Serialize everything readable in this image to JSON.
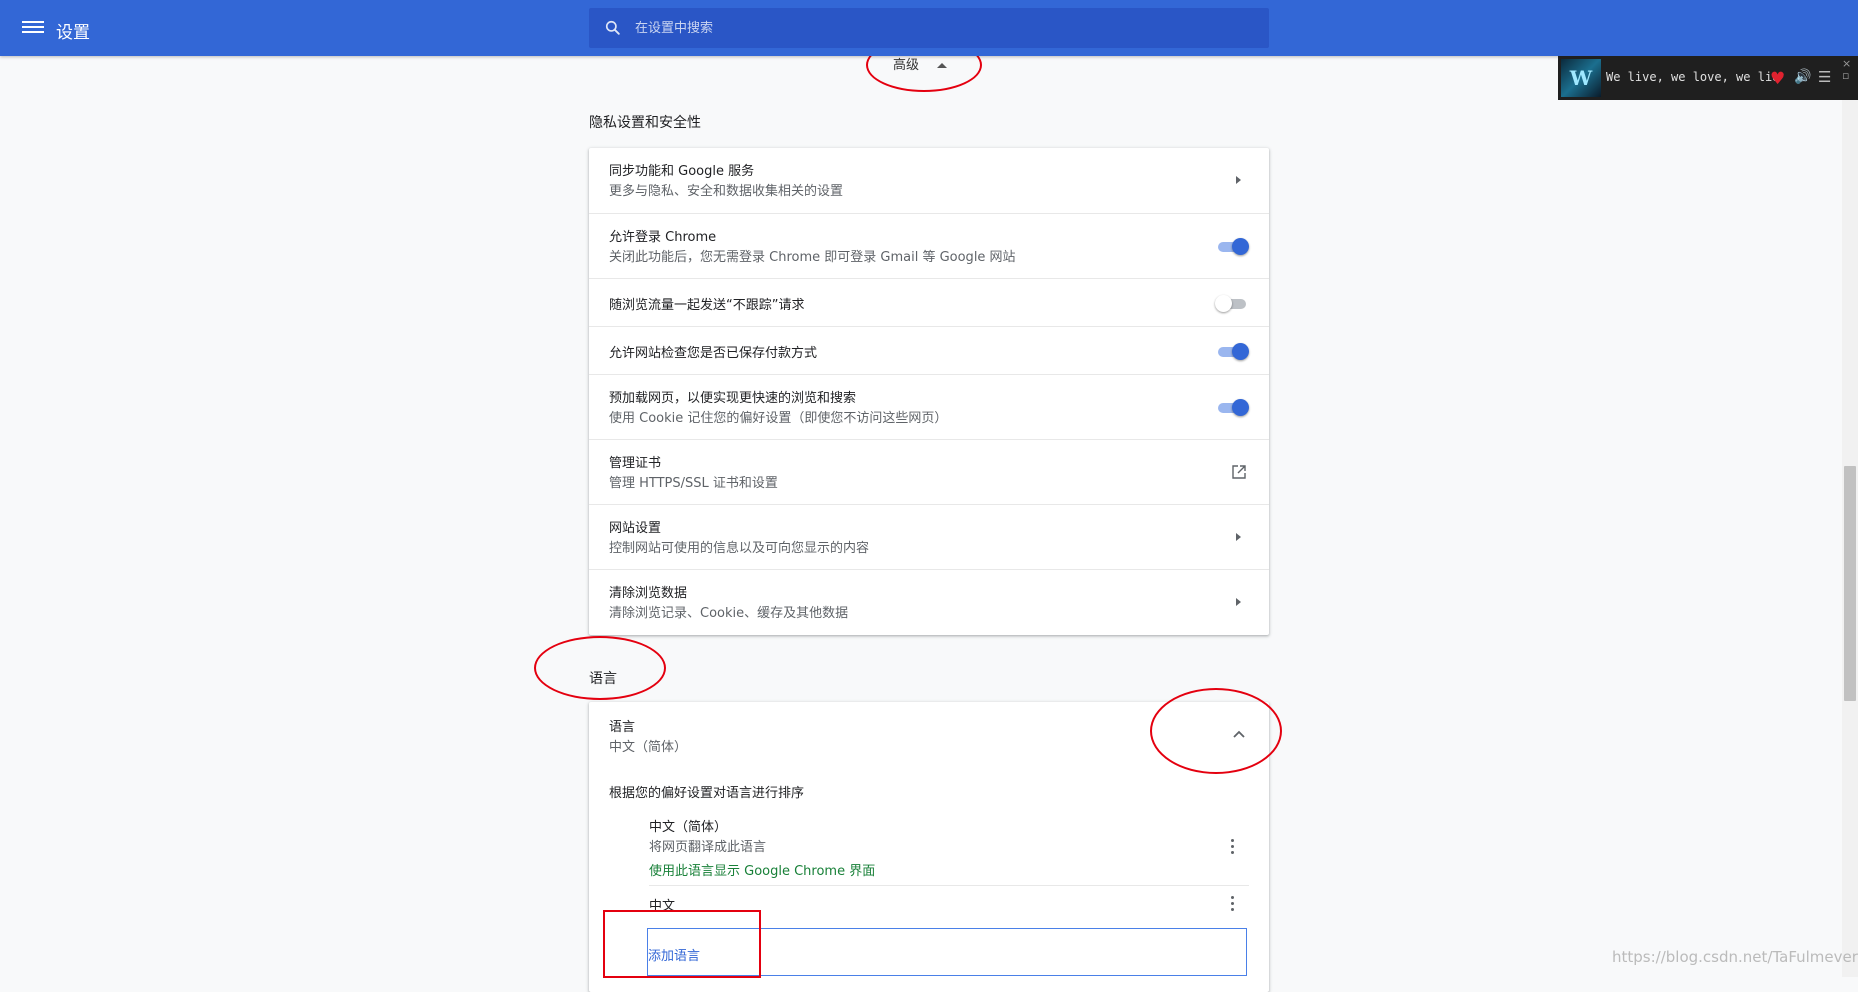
{
  "header": {
    "title": "设置",
    "search_placeholder": "在设置中搜索"
  },
  "music": {
    "thumb_letter": "W",
    "text": "We live, we love, we lie"
  },
  "advanced": {
    "label": "高级"
  },
  "privacy": {
    "section_title": "隐私设置和安全性",
    "rows": [
      {
        "label": "同步功能和 Google 服务",
        "sub": "更多与隐私、安全和数据收集相关的设置",
        "control": "arrow"
      },
      {
        "label": "允许登录 Chrome",
        "sub": "关闭此功能后，您无需登录 Chrome 即可登录 Gmail 等 Google 网站",
        "control": "toggle",
        "state": "on"
      },
      {
        "label": "随浏览流量一起发送“不跟踪”请求",
        "control": "toggle",
        "state": "off"
      },
      {
        "label": "允许网站检查您是否已保存付款方式",
        "control": "toggle",
        "state": "on"
      },
      {
        "label": "预加载网页，以便实现更快速的浏览和搜索",
        "sub": "使用 Cookie 记住您的偏好设置（即使您不访问这些网页）",
        "control": "toggle",
        "state": "on"
      },
      {
        "label": "管理证书",
        "sub": "管理 HTTPS/SSL 证书和设置",
        "control": "external"
      },
      {
        "label": "网站设置",
        "sub": "控制网站可使用的信息以及可向您显示的内容",
        "control": "arrow"
      },
      {
        "label": "清除浏览数据",
        "sub": "清除浏览记录、Cookie、缓存及其他数据",
        "control": "arrow"
      }
    ]
  },
  "languages": {
    "section_title": "语言",
    "header_label": "语言",
    "header_sub": "中文（简体）",
    "order_desc": "根据您的偏好设置对语言进行排序",
    "items": [
      {
        "label": "中文（简体）",
        "sub": "将网页翻译成此语言",
        "note": "使用此语言显示 Google Chrome 界面"
      },
      {
        "label": "中文"
      }
    ],
    "add_label": "添加语言"
  },
  "watermark": "https://blog.csdn.net/TaFulmever"
}
